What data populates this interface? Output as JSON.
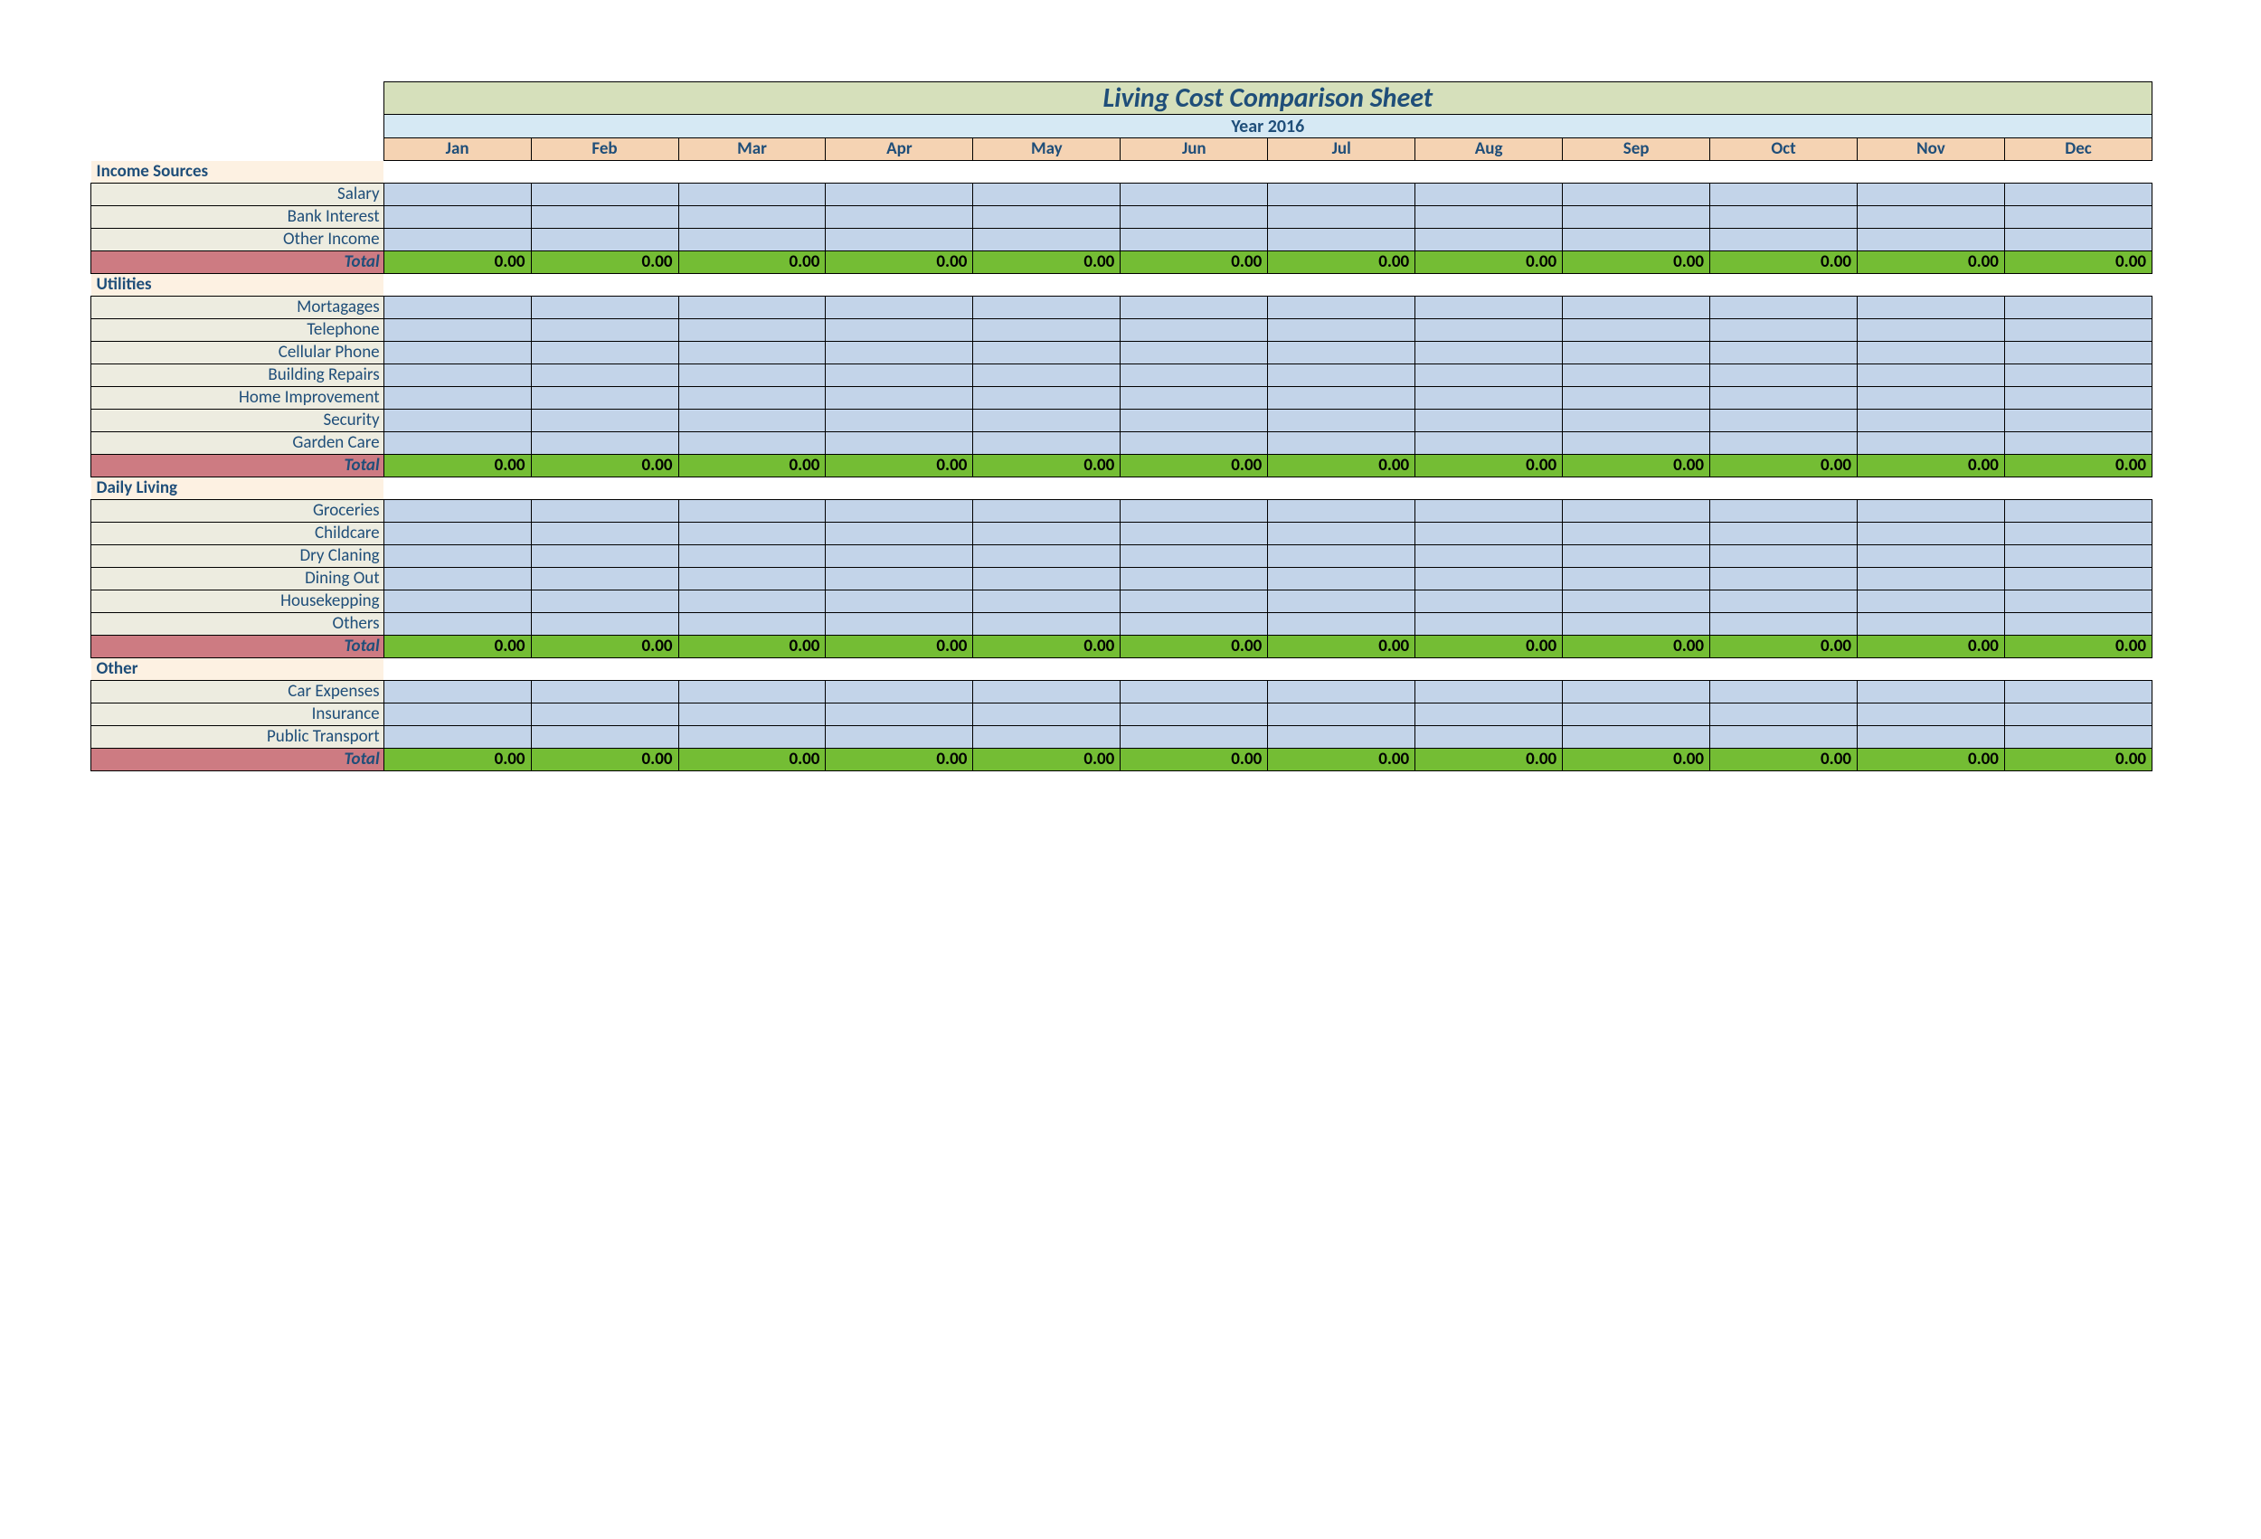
{
  "title": "Living Cost Comparison Sheet",
  "year_label": "Year 2016",
  "months": [
    "Jan",
    "Feb",
    "Mar",
    "Apr",
    "May",
    "Jun",
    "Jul",
    "Aug",
    "Sep",
    "Oct",
    "Nov",
    "Dec"
  ],
  "total_label": "Total",
  "sections": [
    {
      "name": "Income Sources",
      "rows": [
        "Salary",
        "Bank Interest",
        "Other Income"
      ],
      "totals": [
        "0.00",
        "0.00",
        "0.00",
        "0.00",
        "0.00",
        "0.00",
        "0.00",
        "0.00",
        "0.00",
        "0.00",
        "0.00",
        "0.00"
      ]
    },
    {
      "name": "Utilities",
      "rows": [
        "Mortagages",
        "Telephone",
        "Cellular Phone",
        "Building Repairs",
        "Home Improvement",
        "Security",
        "Garden Care"
      ],
      "totals": [
        "0.00",
        "0.00",
        "0.00",
        "0.00",
        "0.00",
        "0.00",
        "0.00",
        "0.00",
        "0.00",
        "0.00",
        "0.00",
        "0.00"
      ]
    },
    {
      "name": "Daily Living",
      "rows": [
        "Groceries",
        "Childcare",
        "Dry Claning",
        "Dining Out",
        "Housekepping",
        "Others"
      ],
      "totals": [
        "0.00",
        "0.00",
        "0.00",
        "0.00",
        "0.00",
        "0.00",
        "0.00",
        "0.00",
        "0.00",
        "0.00",
        "0.00",
        "0.00"
      ]
    },
    {
      "name": "Other",
      "rows": [
        "Car Expenses",
        "Insurance",
        "Public Transport"
      ],
      "totals": [
        "0.00",
        "0.00",
        "0.00",
        "0.00",
        "0.00",
        "0.00",
        "0.00",
        "0.00",
        "0.00",
        "0.00",
        "0.00",
        "0.00"
      ]
    }
  ]
}
